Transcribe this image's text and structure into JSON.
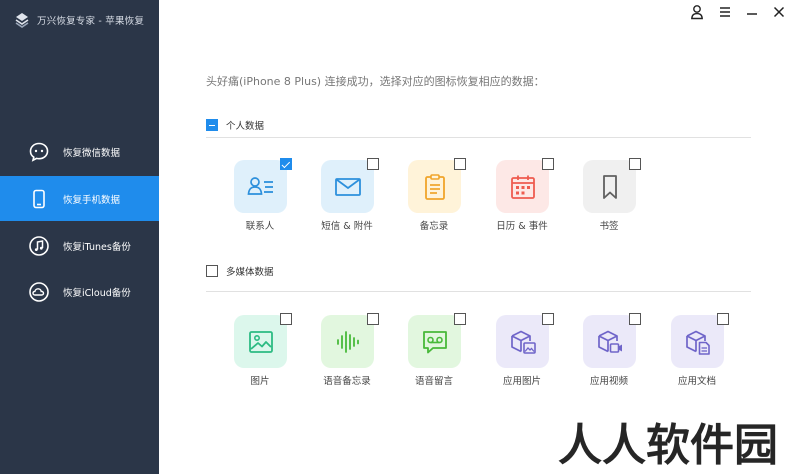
{
  "app": {
    "title": "万兴恢复专家 - 苹果恢复"
  },
  "window_controls": [
    {
      "name": "account-icon",
      "glyph": "♙"
    },
    {
      "name": "menu-icon",
      "glyph": "≡"
    },
    {
      "name": "minimize-icon",
      "glyph": "—"
    },
    {
      "name": "close-icon",
      "glyph": "✕"
    }
  ],
  "sidebar": {
    "items": [
      {
        "label": "恢复微信数据",
        "icon": "wechat-icon",
        "active": false
      },
      {
        "label": "恢复手机数据",
        "icon": "phone-icon",
        "active": true
      },
      {
        "label": "恢复iTunes备份",
        "icon": "music-note-icon",
        "active": false
      },
      {
        "label": "恢复iCloud备份",
        "icon": "cloud-icon",
        "active": false
      }
    ]
  },
  "main": {
    "status": "头好痛(iPhone 8 Plus) 连接成功，选择对应的图标恢复相应的数据：",
    "sections": [
      {
        "label": "个人数据",
        "check_state": "partial",
        "tiles": [
          {
            "label": "联系人",
            "icon": "contacts-icon",
            "checked": true,
            "bg": "#dff0fb",
            "fg": "#2d90dc"
          },
          {
            "label": "短信 & 附件",
            "icon": "message-icon",
            "checked": false,
            "bg": "#dff0fb",
            "fg": "#2d90dc"
          },
          {
            "label": "备忘录",
            "icon": "notes-icon",
            "checked": false,
            "bg": "#fff3d9",
            "fg": "#f0a42a"
          },
          {
            "label": "日历 & 事件",
            "icon": "calendar-icon",
            "checked": false,
            "bg": "#fde8e6",
            "fg": "#ee5b4f"
          },
          {
            "label": "书签",
            "icon": "bookmark-icon",
            "checked": false,
            "bg": "#f0f0f0",
            "fg": "#606060"
          }
        ]
      },
      {
        "label": "多媒体数据",
        "check_state": "unchecked",
        "tiles": [
          {
            "label": "图片",
            "icon": "photo-icon",
            "checked": false,
            "bg": "#dcf7ec",
            "fg": "#2dbb83"
          },
          {
            "label": "语音备忘录",
            "icon": "voice-memo-icon",
            "checked": false,
            "bg": "#e2f7df",
            "fg": "#48b93a"
          },
          {
            "label": "语音留言",
            "icon": "voicemail-icon",
            "checked": false,
            "bg": "#e2f7df",
            "fg": "#48b93a"
          },
          {
            "label": "应用图片",
            "icon": "app-photo-icon",
            "checked": false,
            "bg": "#ebe9f9",
            "fg": "#6f65c9"
          },
          {
            "label": "应用视频",
            "icon": "app-video-icon",
            "checked": false,
            "bg": "#ebe9f9",
            "fg": "#6f65c9"
          },
          {
            "label": "应用文档",
            "icon": "app-document-icon",
            "checked": false,
            "bg": "#ebe9f9",
            "fg": "#6f65c9"
          }
        ]
      }
    ]
  },
  "watermark": "人人软件园",
  "colors": {
    "sidebar_bg": "#2b3648",
    "accent": "#1f8cec"
  }
}
